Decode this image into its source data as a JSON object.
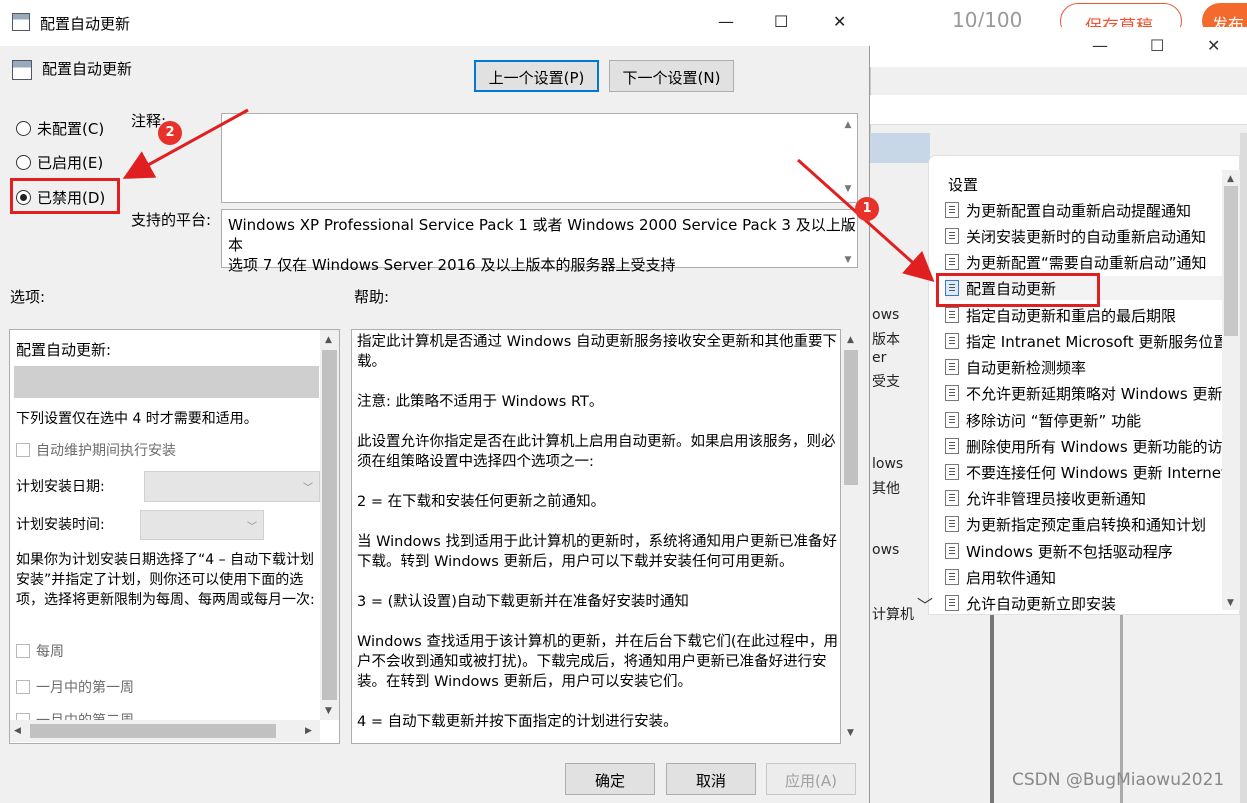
{
  "background": {
    "counter": "10/100",
    "save_draft": "保存草稿",
    "publish": "发布",
    "fragments": [
      "ows",
      "版本",
      "er",
      "受支",
      "lows",
      "其他",
      "ows",
      "计算机"
    ],
    "policy_list": {
      "header": "设置",
      "items": [
        "为更新配置自动重新启动提醒通知",
        "关闭安装更新时的自动重新启动通知",
        "为更新配置“需要自动重新启动”通知",
        "配置自动更新",
        "指定自动更新和重启的最后期限",
        "指定 Intranet Microsoft 更新服务位置",
        "自动更新检测频率",
        "不允许更新延期策略对 Windows 更新扫描",
        "移除访问 “暂停更新” 功能",
        "删除使用所有 Windows 更新功能的访问",
        "不要连接任何 Windows 更新 Internet 位置",
        "允许非管理员接收更新通知",
        "为更新指定预定重启转换和通知计划",
        "Windows 更新不包括驱动程序",
        "启用软件通知",
        "允许自动更新立即安装"
      ],
      "selected_index": 3
    },
    "watermark": "CSDN @BugMiaowu2021"
  },
  "dialog": {
    "title": "配置自动更新",
    "subtitle": "配置自动更新",
    "prev_setting": "上一个设置(P)",
    "next_setting": "下一个设置(N)",
    "radios": [
      {
        "label": "未配置(C)",
        "checked": false
      },
      {
        "label": "已启用(E)",
        "checked": false
      },
      {
        "label": "已禁用(D)",
        "checked": true
      }
    ],
    "comment_label": "注释:",
    "platform_label": "支持的平台:",
    "platform_text_1": "Windows XP Professional Service Pack 1 或者 Windows 2000 Service Pack 3 及以上版本",
    "platform_text_2": "选项 7 仅在 Windows Server 2016 及以上版本的服务器上受支持",
    "options_label": "选项:",
    "help_label": "帮助:",
    "options": {
      "configure_label": "配置自动更新:",
      "note": "下列设置仅在选中 4 时才需要和适用。",
      "maintenance_install": "自动维护期间执行安装",
      "schedule_day_label": "计划安装日期:",
      "schedule_time_label": "计划安装时间:",
      "para_1": "如果你为计划安装日期选择了“4 – 自动下载计划安装”并指定了计划，则你还可以使用下面的选项，选择将更新限制为每周、每两周或每月一次:",
      "weekly": "每周",
      "first_week": "一月中的第一周",
      "second_week": "一月中的第二周"
    },
    "help": [
      "指定此计算机是否通过 Windows 自动更新服务接收安全更新和其他重要下载。",
      "注意: 此策略不适用于 Windows RT。",
      "此设置允许你指定是否在此计算机上启用自动更新。如果启用该服务，则必须在组策略设置中选择四个选项之一:",
      " 2 = 在下载和安装任何更新之前通知。",
      " 当 Windows 找到适用于此计算机的更新时，系统将通知用户更新已准备好下载。转到 Windows 更新后，用户可以下载并安装任何可用更新。",
      " 3 = (默认设置)自动下载更新并在准备好安装时通知",
      " Windows 查找适用于该计算机的更新，并在后台下载它们(在此过程中，用户不会收到通知或被打扰)。下载完成后，将通知用户更新已准备好进行安装。在转到 Windows 更新后，用户可以安装它们。",
      " 4 = 自动下载更新并按下面指定的计划进行安装。"
    ],
    "ok": "确定",
    "cancel": "取消",
    "apply": "应用(A)"
  },
  "badges": {
    "one": "1",
    "two": "2"
  },
  "colors": {
    "annotation_red": "#e02020",
    "badge_red": "#e8312b",
    "dialog_bg": "#f0f0f0"
  }
}
